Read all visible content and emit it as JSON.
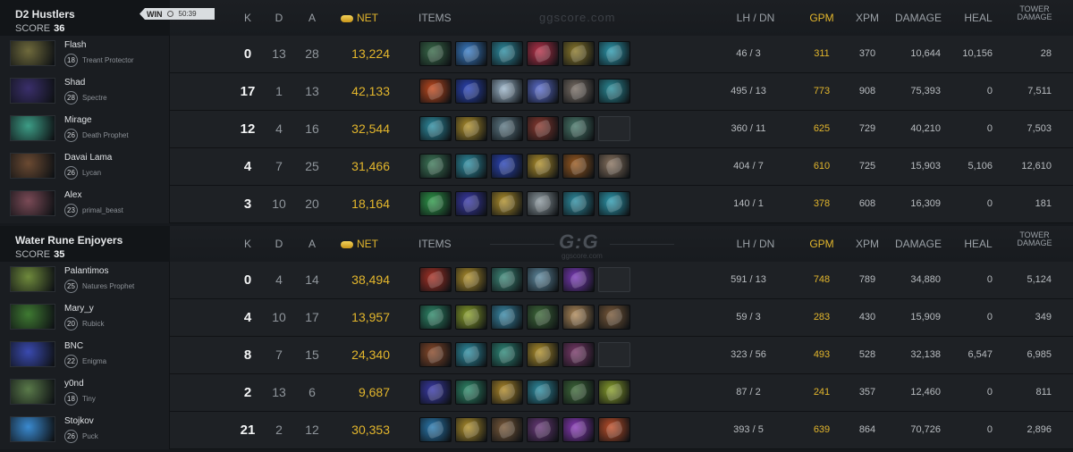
{
  "watermark": {
    "site": "ggscore.com",
    "logo": "G:G",
    "logo_sub": "ggscore.com"
  },
  "headers": {
    "k": "K",
    "d": "D",
    "a": "A",
    "net": "NET",
    "items": "ITEMS",
    "lh_dn": "LH / DN",
    "gpm": "GPM",
    "xpm": "XPM",
    "damage": "DAMAGE",
    "heal": "HEAL",
    "tower_damage_1": "TOWER",
    "tower_damage_2": "DAMAGE"
  },
  "teams": [
    {
      "name": "D2 Hustlers",
      "score_label": "SCORE",
      "score": "36",
      "result": "WIN",
      "duration": "50:39",
      "players": [
        {
          "name": "Flash",
          "level": "18",
          "hero": "Treant Protector",
          "k": "0",
          "d": "13",
          "a": "28",
          "net": "13,224",
          "lh_dn": "46 / 3",
          "gpm": "311",
          "xpm": "370",
          "damage": "10,644",
          "heal": "10,156",
          "tower": "28",
          "portrait_color": "#6f6a3c",
          "items": [
            "#3a6b4a",
            "#3b7ec8",
            "#2f8fa3",
            "#b7324a",
            "#8c7a2c",
            "#2e9bb0"
          ]
        },
        {
          "name": "Shad",
          "level": "28",
          "hero": "Spectre",
          "k": "17",
          "d": "1",
          "a": "13",
          "net": "42,133",
          "lh_dn": "495 / 13",
          "gpm": "773",
          "xpm": "908",
          "damage": "75,393",
          "heal": "0",
          "tower": "7,511",
          "portrait_color": "#3a2f6b",
          "items": [
            "#c24a1e",
            "#2b45b8",
            "#9eb7cc",
            "#5d6fd0",
            "#7a6f66",
            "#2b8d9a"
          ]
        },
        {
          "name": "Mirage",
          "level": "26",
          "hero": "Death Prophet",
          "k": "12",
          "d": "4",
          "a": "16",
          "net": "32,544",
          "lh_dn": "360 / 11",
          "gpm": "625",
          "xpm": "729",
          "damage": "40,210",
          "heal": "0",
          "tower": "7,503",
          "portrait_color": "#3d9d86",
          "items": [
            "#2f8fa3",
            "#b0902c",
            "#5f7a86",
            "#8a3a30",
            "#4b7a6c",
            "empty"
          ]
        },
        {
          "name": "Davai Lama",
          "level": "26",
          "hero": "Lycan",
          "k": "4",
          "d": "7",
          "a": "25",
          "net": "31,466",
          "lh_dn": "404 / 7",
          "gpm": "610",
          "xpm": "725",
          "damage": "15,903",
          "heal": "5,106",
          "tower": "12,610",
          "portrait_color": "#6b4a32",
          "items": [
            "#3f7a5a",
            "#2f8fa3",
            "#2b45b8",
            "#b0902c",
            "#9a5a20",
            "#8a7460"
          ]
        },
        {
          "name": "Alex",
          "level": "23",
          "hero": "primal_beast",
          "k": "3",
          "d": "10",
          "a": "20",
          "net": "18,164",
          "lh_dn": "140 / 1",
          "gpm": "378",
          "xpm": "608",
          "damage": "16,309",
          "heal": "0",
          "tower": "181",
          "portrait_color": "#7a4a56",
          "items": [
            "#2f9a4a",
            "#3a3aa8",
            "#b0902c",
            "#8e9aa0",
            "#2f8fa3",
            "#2e9bb0"
          ]
        }
      ]
    },
    {
      "name": "Water Rune Enjoyers",
      "score_label": "SCORE",
      "score": "35",
      "players": [
        {
          "name": "Palantimos",
          "level": "25",
          "hero": "Natures Prophet",
          "k": "0",
          "d": "4",
          "a": "14",
          "net": "38,494",
          "lh_dn": "591 / 13",
          "gpm": "748",
          "xpm": "789",
          "damage": "34,880",
          "heal": "0",
          "tower": "5,124",
          "portrait_color": "#6f8a3c",
          "items": [
            "#a83226",
            "#b0902c",
            "#3f8a7a",
            "#5f8aa0",
            "#7a3ab8",
            "empty"
          ]
        },
        {
          "name": "Mary_y",
          "level": "20",
          "hero": "Rubick",
          "k": "4",
          "d": "10",
          "a": "17",
          "net": "13,957",
          "lh_dn": "59 / 3",
          "gpm": "283",
          "xpm": "430",
          "damage": "15,909",
          "heal": "0",
          "tower": "349",
          "portrait_color": "#3f7a32",
          "items": [
            "#2f8a6a",
            "#8aa02c",
            "#3a8aa8",
            "#3f6a3a",
            "#b08a5a",
            "#7a5a3a"
          ]
        },
        {
          "name": "BNC",
          "level": "22",
          "hero": "Enigma",
          "k": "8",
          "d": "7",
          "a": "15",
          "net": "24,340",
          "lh_dn": "323 / 56",
          "gpm": "493",
          "xpm": "528",
          "damage": "32,138",
          "heal": "6,547",
          "tower": "6,985",
          "portrait_color": "#3a4ab0",
          "items": [
            "#8a4a2a",
            "#2f8fa3",
            "#2f8a7a",
            "#b0902c",
            "#7a3a6a",
            "empty"
          ]
        },
        {
          "name": "y0nd",
          "level": "18",
          "hero": "Tiny",
          "k": "2",
          "d": "13",
          "a": "6",
          "net": "9,687",
          "lh_dn": "87 / 2",
          "gpm": "241",
          "xpm": "357",
          "damage": "12,460",
          "heal": "0",
          "tower": "811",
          "portrait_color": "#5a7a4a",
          "items": [
            "#3a3aa8",
            "#2f8a6a",
            "#b08a2a",
            "#2f8fa3",
            "#3f6a3a",
            "#8aa02c"
          ]
        },
        {
          "name": "Stojkov",
          "level": "26",
          "hero": "Puck",
          "k": "21",
          "d": "2",
          "a": "12",
          "net": "30,353",
          "lh_dn": "393 / 5",
          "gpm": "639",
          "xpm": "864",
          "damage": "70,726",
          "heal": "0",
          "tower": "2,896",
          "portrait_color": "#3a8ad0",
          "items": [
            "#2a7ab0",
            "#b0902c",
            "#7a5a3a",
            "#6a3a7a",
            "#8a3ab8",
            "#c0502a"
          ]
        }
      ]
    }
  ]
}
